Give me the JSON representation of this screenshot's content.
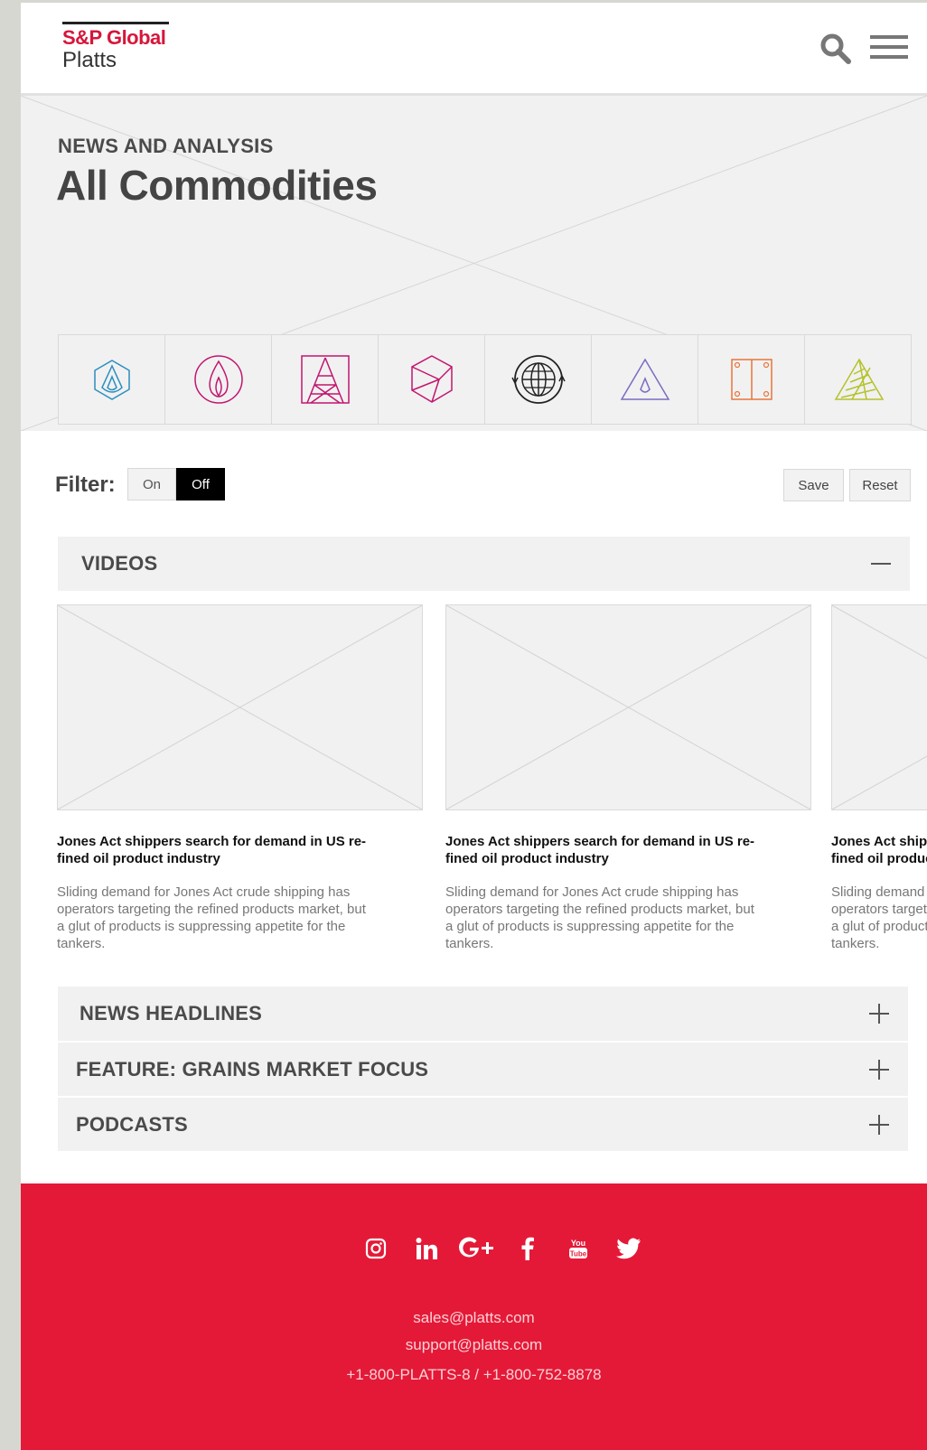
{
  "header": {
    "logo_brand": "S&P Global",
    "logo_sub": "Platts"
  },
  "hero": {
    "kicker": "NEWS AND ANALYSIS",
    "title": "All Commodities",
    "tiles": [
      {
        "icon": "oil-drop-hexagon-icon",
        "color": "#2a8ec0"
      },
      {
        "icon": "gas-flame-circle-icon",
        "color": "#c2156f"
      },
      {
        "icon": "power-tower-icon",
        "color": "#c2156f"
      },
      {
        "icon": "metals-cube-icon",
        "color": "#c2156f"
      },
      {
        "icon": "globe-cycle-icon",
        "color": "#222222"
      },
      {
        "icon": "water-drop-triangle-icon",
        "color": "#7a6cc0"
      },
      {
        "icon": "shipping-container-icon",
        "color": "#e8753a"
      },
      {
        "icon": "agriculture-triangle-icon",
        "color": "#b5c22a"
      }
    ]
  },
  "filter": {
    "label": "Filter:",
    "on_label": "On",
    "off_label": "Off",
    "save_label": "Save",
    "reset_label": "Reset"
  },
  "sections": {
    "videos": "VIDEOS",
    "news": "NEWS HEADLINES",
    "grains": "FEATURE: GRAINS MARKET FOCUS",
    "podcasts": "PODCASTS"
  },
  "videos": [
    {
      "title": "Jones Act shippers search for demand in US re-fined oil product industry",
      "desc": "Sliding demand for Jones Act crude shipping has operators targeting the refined products market, but a glut of products is suppressing appetite for the tankers."
    },
    {
      "title": "Jones Act shippers search for demand in US re-fined oil product industry",
      "desc": "Sliding demand for Jones Act crude shipping has operators targeting the refined products market, but a glut of products is suppressing appetite for the tankers."
    },
    {
      "title": "Jones Act shippers search for demand in US re-fined oil product industry",
      "desc": "Sliding demand for Jones Act crude shipping has operators targeting the refined products market, but a glut of products is suppressing appetite for the tankers."
    }
  ],
  "footer": {
    "social": [
      "instagram-icon",
      "linkedin-icon",
      "google-plus-icon",
      "facebook-icon",
      "youtube-icon",
      "twitter-icon"
    ],
    "sales_email": "sales@platts.com",
    "support_email": "support@platts.com",
    "phone": "+1-800-PLATTS-8 / +1-800-752-8878"
  },
  "colors": {
    "brand_red": "#d6163b",
    "footer_red": "#e41937",
    "panel_gray": "#f1f1f1"
  }
}
